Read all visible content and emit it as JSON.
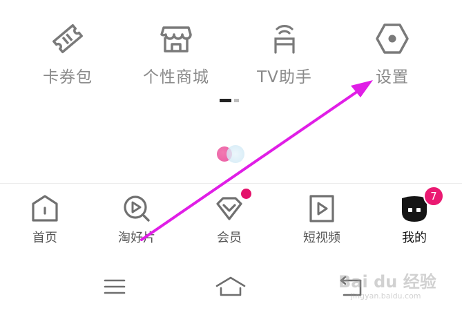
{
  "grid": {
    "items": [
      {
        "label": "卡券包",
        "icon": "ticket-icon"
      },
      {
        "label": "个性商城",
        "icon": "shop-icon"
      },
      {
        "label": "TV助手",
        "icon": "tv-remote-icon"
      },
      {
        "label": "设置",
        "icon": "settings-hexagon-icon"
      }
    ]
  },
  "pager": {
    "pages": 2,
    "current": 1
  },
  "bottom_nav": {
    "items": [
      {
        "label": "首页",
        "icon": "home-icon"
      },
      {
        "label": "淘好片",
        "icon": "search-play-icon"
      },
      {
        "label": "会员",
        "icon": "vip-diamond-icon",
        "dot": true
      },
      {
        "label": "短视频",
        "icon": "play-square-icon"
      },
      {
        "label": "我的",
        "icon": "profile-icon",
        "badge": "7",
        "active": true
      }
    ]
  },
  "system_nav": {
    "items": [
      {
        "icon": "menu-icon"
      },
      {
        "icon": "home-outline-icon"
      },
      {
        "icon": "back-icon"
      }
    ]
  },
  "annotation": {
    "type": "arrow",
    "color": "#e01ee6",
    "target": "设置"
  },
  "watermark": {
    "text": "Bai du 经验",
    "url": "jingyan.baidu.com"
  },
  "colors": {
    "label_gray": "#8a8a8a",
    "accent_pink": "#ea1a72",
    "arrow": "#e01ee6"
  }
}
